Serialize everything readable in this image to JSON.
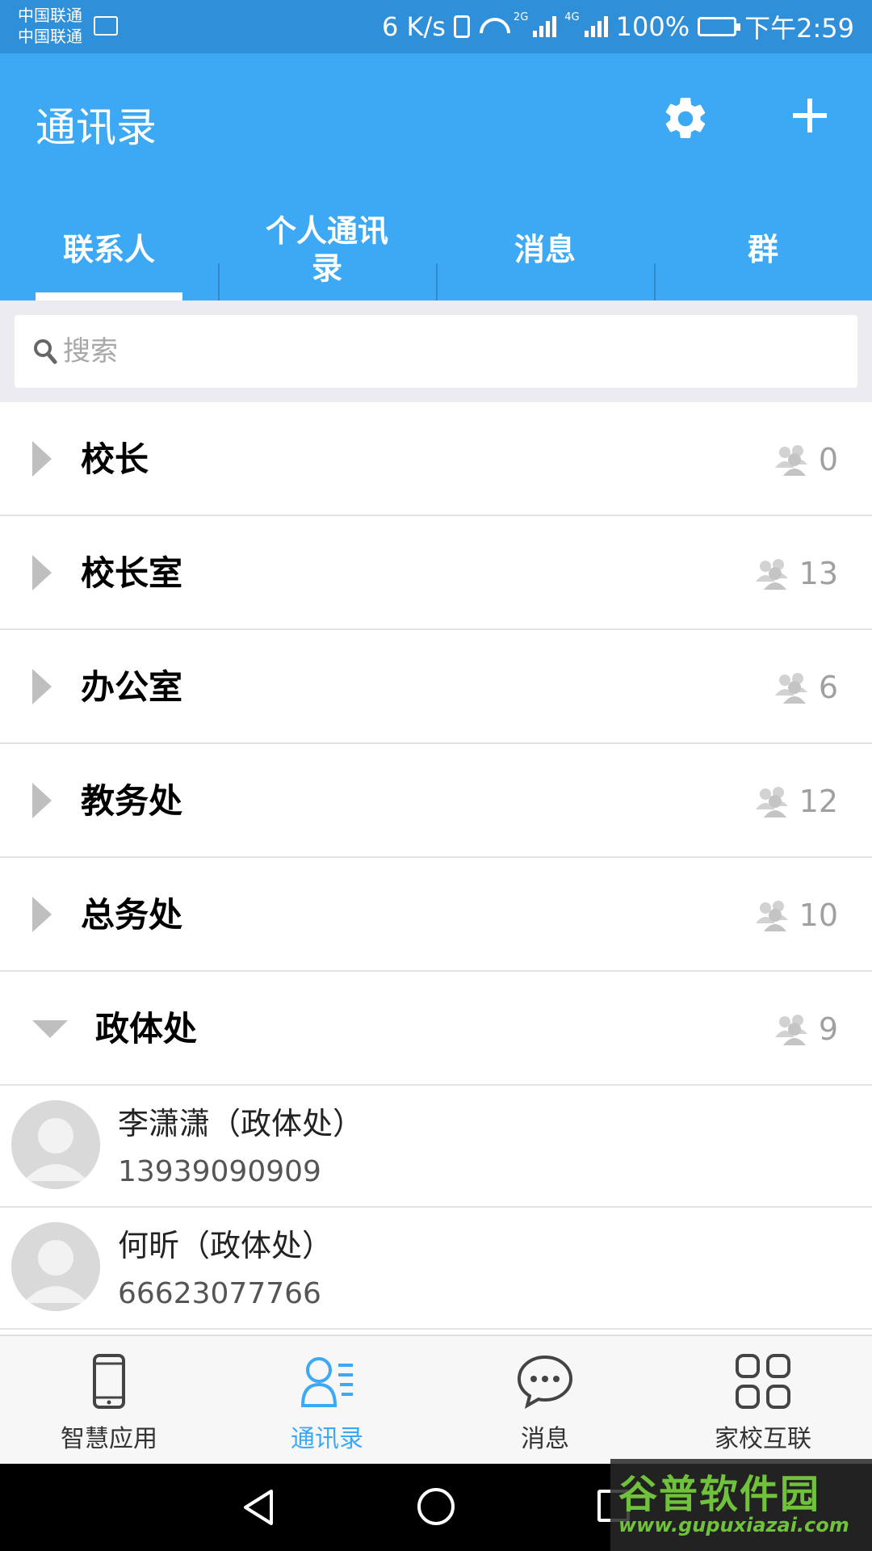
{
  "status_bar": {
    "carrier_1": "中国联通",
    "carrier_2": "中国联通",
    "net_speed": "6 K/s",
    "sim1_type": "2G",
    "sim2_type": "4G",
    "battery": "100%",
    "time": "下午2:59"
  },
  "header": {
    "title": "通讯录",
    "settings_icon": "gear-icon",
    "add_icon": "plus-icon"
  },
  "tabs": [
    {
      "label": "联系人",
      "active": true
    },
    {
      "label": "个人通讯录",
      "active": false
    },
    {
      "label": "消息",
      "active": false
    },
    {
      "label": "群",
      "active": false
    }
  ],
  "search": {
    "placeholder": "搜索"
  },
  "groups": [
    {
      "name": "校长",
      "count": "0",
      "expanded": false
    },
    {
      "name": "校长室",
      "count": "13",
      "expanded": false
    },
    {
      "name": "办公室",
      "count": "6",
      "expanded": false
    },
    {
      "name": "教务处",
      "count": "12",
      "expanded": false
    },
    {
      "name": "总务处",
      "count": "10",
      "expanded": false
    },
    {
      "name": "政体处",
      "count": "9",
      "expanded": true
    }
  ],
  "contacts": [
    {
      "name": "李潇潇（政体处）",
      "phone": "13939090909"
    },
    {
      "name": "何昕（政体处）",
      "phone": "66623077766"
    }
  ],
  "bottom_nav": [
    {
      "label": "智慧应用",
      "icon": "phone-icon",
      "active": false
    },
    {
      "label": "通讯录",
      "icon": "contacts-icon",
      "active": true
    },
    {
      "label": "消息",
      "icon": "chat-bubble-icon",
      "active": false
    },
    {
      "label": "家校互联",
      "icon": "grid-icon",
      "active": false
    }
  ],
  "watermark": {
    "logo": "谷普软件园",
    "url": "www.gupuxiazai.com"
  },
  "colors": {
    "accent": "#3da9f4",
    "status_bar": "#2f8fd9",
    "count_grey": "#a0a0a0",
    "watermark_green": "#6fc23a"
  }
}
